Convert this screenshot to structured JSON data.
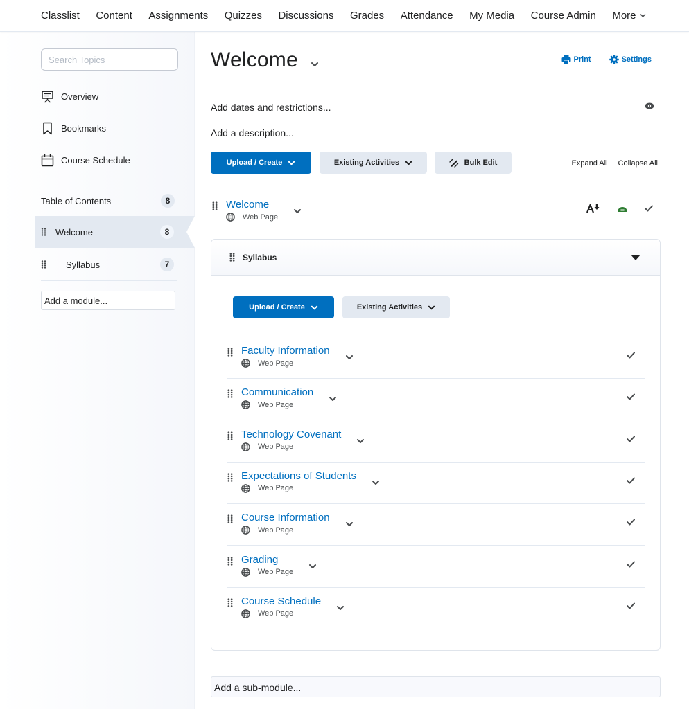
{
  "topnav": {
    "items": [
      {
        "label": "Classlist"
      },
      {
        "label": "Content"
      },
      {
        "label": "Assignments"
      },
      {
        "label": "Quizzes"
      },
      {
        "label": "Discussions"
      },
      {
        "label": "Grades"
      },
      {
        "label": "Attendance"
      },
      {
        "label": "My Media"
      },
      {
        "label": "Course Admin"
      },
      {
        "label": "More"
      }
    ]
  },
  "sidebar": {
    "search_placeholder": "Search Topics",
    "links": [
      {
        "label": "Overview",
        "icon": "presentation-icon"
      },
      {
        "label": "Bookmarks",
        "icon": "bookmark-icon"
      },
      {
        "label": "Course Schedule",
        "icon": "calendar-icon"
      }
    ],
    "toc": {
      "label": "Table of Contents",
      "count": "8",
      "modules": [
        {
          "label": "Welcome",
          "count": "8",
          "active": true
        },
        {
          "label": "Syllabus",
          "count": "7",
          "active": false
        }
      ]
    },
    "add_module_placeholder": "Add a module..."
  },
  "main": {
    "title": "Welcome",
    "print_label": "Print",
    "settings_label": "Settings",
    "dates_link": "Add dates and restrictions...",
    "description_link": "Add a description...",
    "upload_create_label": "Upload / Create",
    "existing_activities_label": "Existing Activities",
    "bulk_edit_label": "Bulk Edit",
    "expand_all": "Expand All",
    "collapse_all": "Collapse All",
    "topic": {
      "name": "Welcome",
      "type": "Web Page"
    },
    "accent_color": "#006fbf",
    "status_color": "#2e7d32",
    "submodule": {
      "title": "Syllabus",
      "upload_create_label": "Upload / Create",
      "existing_activities_label": "Existing Activities",
      "items": [
        {
          "name": "Faculty Information",
          "type": "Web Page"
        },
        {
          "name": "Communication",
          "type": "Web Page"
        },
        {
          "name": "Technology Covenant",
          "type": "Web Page"
        },
        {
          "name": "Expectations of Students",
          "type": "Web Page"
        },
        {
          "name": "Course Information",
          "type": "Web Page"
        },
        {
          "name": "Grading",
          "type": "Web Page"
        },
        {
          "name": "Course Schedule",
          "type": "Web Page"
        }
      ]
    },
    "add_submodule_placeholder": "Add a sub-module..."
  }
}
